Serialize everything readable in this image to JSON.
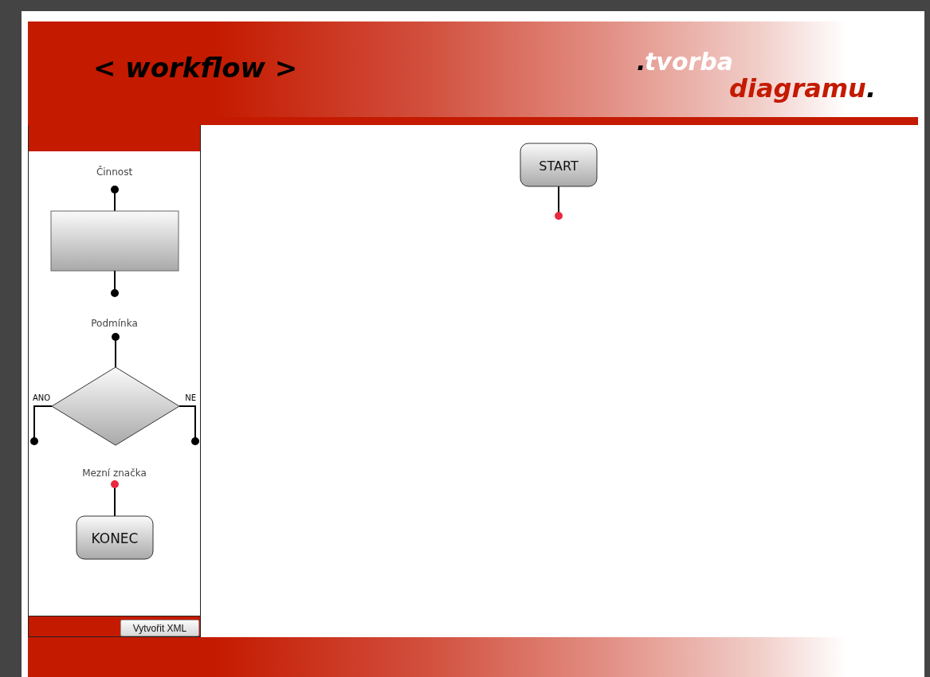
{
  "header": {
    "title": "< workflow >",
    "brand_dot": ".",
    "brand_top": "tvorba",
    "brand_bottom": "diagramu",
    "brand_end": "."
  },
  "palette": [
    {
      "kind": "activity",
      "label": "Činnost"
    },
    {
      "kind": "condition",
      "label": "Podmínka",
      "yes": "ANO",
      "no": "NE"
    },
    {
      "kind": "terminator",
      "label": "Mezní značka",
      "text": "KONEC"
    }
  ],
  "toolbar": {
    "button": "Vytvořit XML"
  },
  "canvas": {
    "nodes": [
      {
        "kind": "terminator",
        "text": "START"
      }
    ]
  }
}
